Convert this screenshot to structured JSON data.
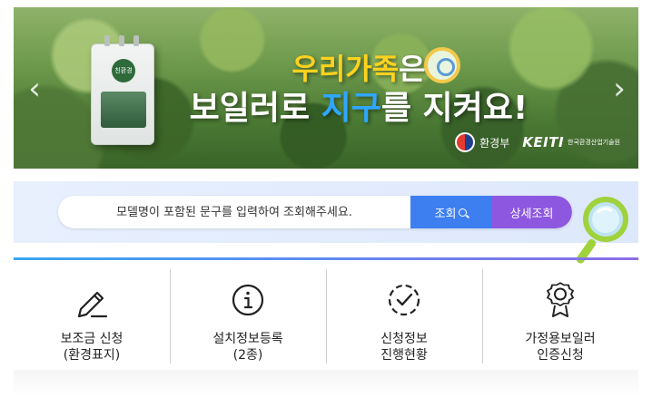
{
  "banner": {
    "headline_line1_accent": "우리가족",
    "headline_line1_rest": "은",
    "headline_line2_pre": "보일러로 ",
    "headline_line2_accent": "지구",
    "headline_line2_post": "를 지켜요!",
    "boiler_badge": "친환경",
    "logo_ministry": "환경부",
    "logo_keiti": "KEITI",
    "logo_keiti_sub": "한국환경산업기술원",
    "prev_icon": "chevron-left-icon",
    "next_icon": "chevron-right-icon"
  },
  "search": {
    "placeholder": "모델명이 포함된 문구를 입력하여 조회해주세요.",
    "search_label": "조회",
    "detail_label": "상세조회"
  },
  "menu": {
    "items": [
      {
        "label": "보조금 신청\n(환경표지)",
        "icon": "pencil-icon"
      },
      {
        "label": "설치정보등록\n(2종)",
        "icon": "info-icon"
      },
      {
        "label": "신청정보\n진행현황",
        "icon": "check-circle-icon"
      },
      {
        "label": "가정용보일러\n인증신청",
        "icon": "award-icon"
      }
    ]
  },
  "colors": {
    "search_button": "#3d7ff0",
    "detail_button": "#8d57e0",
    "headline_yellow": "#ffd21e",
    "headline_blue": "#2fa6ff"
  }
}
